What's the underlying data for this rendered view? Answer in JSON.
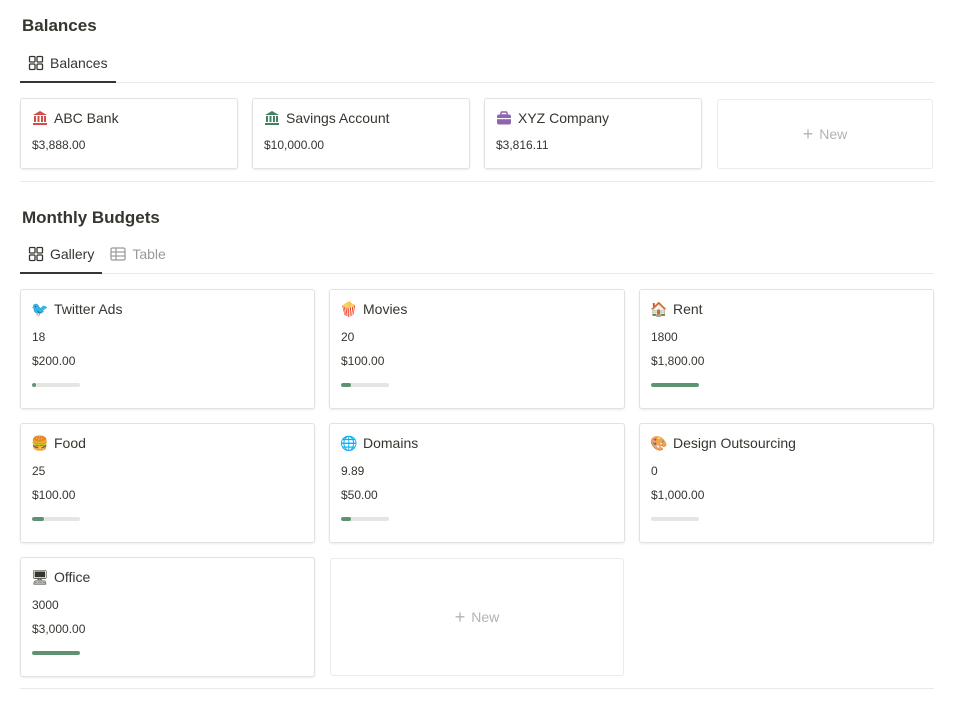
{
  "balances": {
    "title": "Balances",
    "tabs": [
      {
        "label": "Balances",
        "icon": "gallery-icon",
        "active": true
      }
    ],
    "cards": [
      {
        "name": "ABC Bank",
        "amount": "$3,888.00",
        "icon": "bank-icon",
        "icon_color": "#d44c47"
      },
      {
        "name": "Savings Account",
        "amount": "$10,000.00",
        "icon": "bank-icon",
        "icon_color": "#448361"
      },
      {
        "name": "XYZ Company",
        "amount": "$3,816.11",
        "icon": "briefcase-icon",
        "icon_color": "#9065b0"
      }
    ],
    "new_label": "New"
  },
  "budgets": {
    "title": "Monthly Budgets",
    "tabs": [
      {
        "label": "Gallery",
        "icon": "gallery-icon",
        "active": true
      },
      {
        "label": "Table",
        "icon": "table-icon",
        "active": false
      }
    ],
    "cards": [
      {
        "name": "Twitter Ads",
        "emoji": "🐦",
        "spent": "18",
        "budget": "$200.00",
        "progress": 0.09
      },
      {
        "name": "Movies",
        "emoji": "🍿",
        "spent": "20",
        "budget": "$100.00",
        "progress": 0.2
      },
      {
        "name": "Rent",
        "emoji": "🏠",
        "spent": "1800",
        "budget": "$1,800.00",
        "progress": 1.0
      },
      {
        "name": "Food",
        "emoji": "🍔",
        "spent": "25",
        "budget": "$100.00",
        "progress": 0.25
      },
      {
        "name": "Domains",
        "emoji": "🌐",
        "spent": "9.89",
        "budget": "$50.00",
        "progress": 0.2
      },
      {
        "name": "Design Outsourcing",
        "emoji": "🎨",
        "spent": "0",
        "budget": "$1,000.00",
        "progress": 0.0
      },
      {
        "name": "Office",
        "emoji": "🖥",
        "spent": "3000",
        "budget": "$3,000.00",
        "progress": 1.0
      }
    ],
    "new_label": "New"
  },
  "colors": {
    "accent_green": "#5f9271",
    "text": "#37352f",
    "muted": "#9b9a97"
  }
}
